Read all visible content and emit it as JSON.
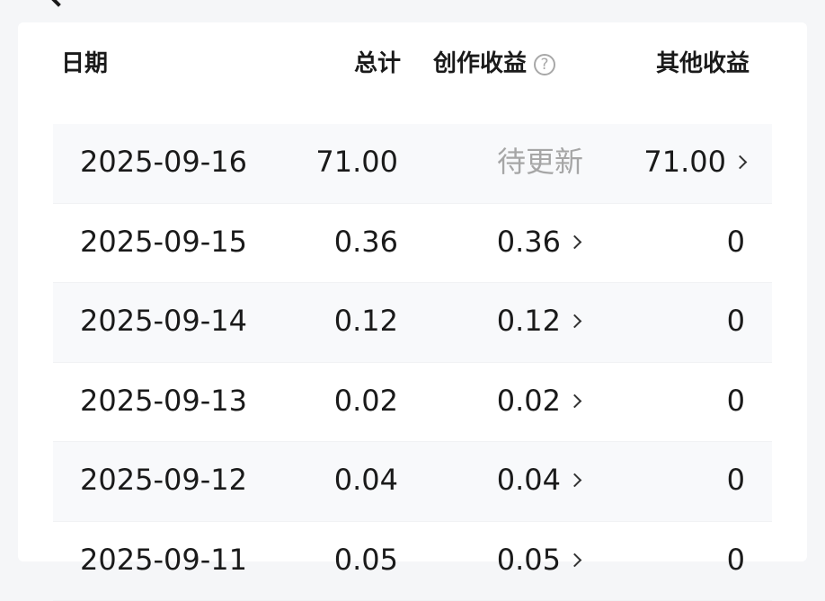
{
  "header": {
    "date_label": "日期",
    "total_label": "总计",
    "creation_label": "创作收益",
    "help_icon": "?",
    "other_label": "其他收益"
  },
  "rows": [
    {
      "date": "2025-09-16",
      "total": "71.00",
      "creation": "待更新",
      "other": "71.00"
    },
    {
      "date": "2025-09-15",
      "total": "0.36",
      "creation": "0.36",
      "other": "0"
    },
    {
      "date": "2025-09-14",
      "total": "0.12",
      "creation": "0.12",
      "other": "0"
    },
    {
      "date": "2025-09-13",
      "total": "0.02",
      "creation": "0.02",
      "other": "0"
    },
    {
      "date": "2025-09-12",
      "total": "0.04",
      "creation": "0.04",
      "other": "0"
    },
    {
      "date": "2025-09-11",
      "total": "0.05",
      "creation": "0.05",
      "other": "0"
    }
  ],
  "icons": {
    "back": "back-arrow-icon",
    "help": "question-circle-icon",
    "chevron": "chevron-right-icon"
  }
}
